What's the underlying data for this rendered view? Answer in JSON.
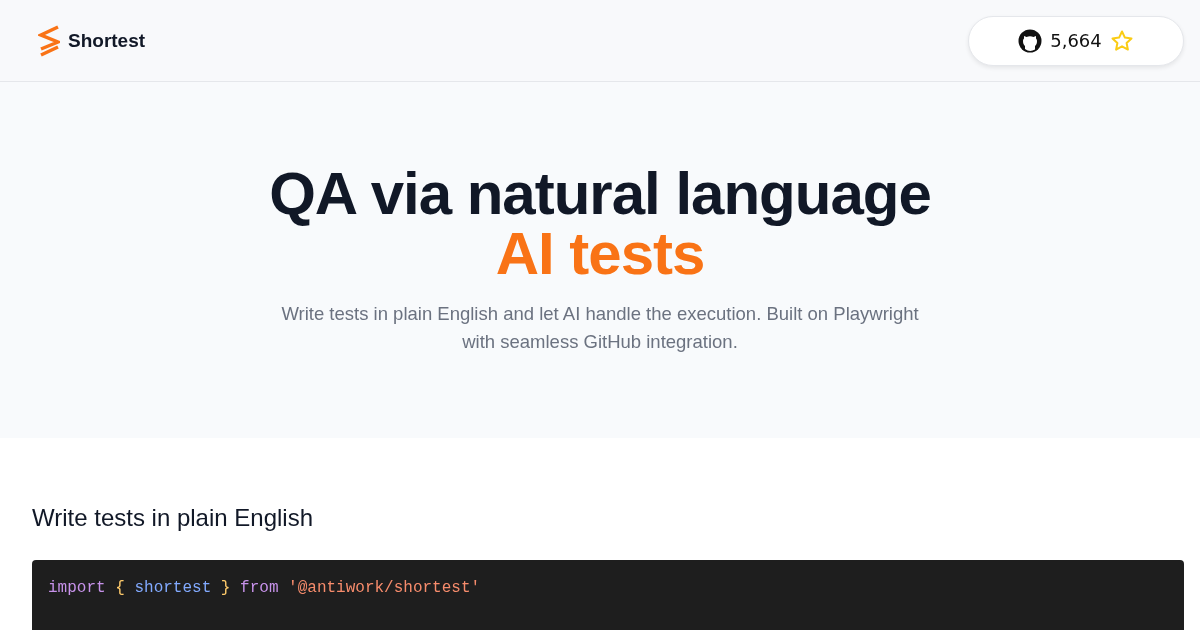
{
  "header": {
    "logo_text": "Shortest",
    "github_button": {
      "count": "5,664"
    }
  },
  "hero": {
    "title": "QA via natural language",
    "highlight": "AI tests",
    "subtitle": "Write tests in plain English and let AI handle the execution. Built on Playwright with seamless GitHub integration."
  },
  "section": {
    "heading": "Write tests in plain English",
    "code_lines": [
      [
        {
          "kind": "keyword",
          "text": "import"
        },
        {
          "kind": "punct",
          "text": "{"
        },
        {
          "kind": "ident",
          "text": "shortest"
        },
        {
          "kind": "punct",
          "text": "}"
        },
        {
          "kind": "keyword",
          "text": "from"
        },
        {
          "kind": "string",
          "text": "'@antiwork/shortest'"
        }
      ]
    ]
  }
}
